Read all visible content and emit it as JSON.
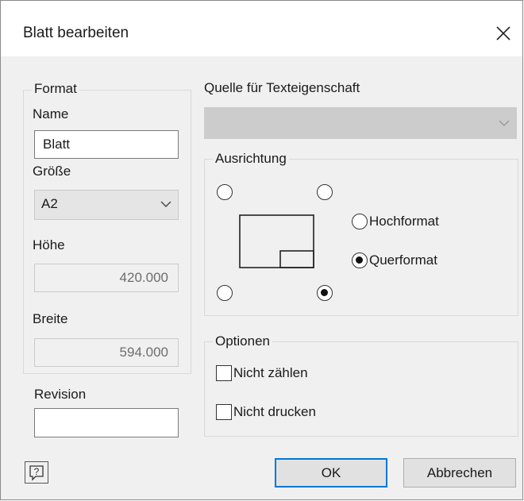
{
  "dialog": {
    "title": "Blatt bearbeiten",
    "close_icon": "close-icon"
  },
  "format": {
    "legend": "Format",
    "name_label": "Name",
    "name_value": "Blatt",
    "size_label": "Größe",
    "size_value": "A2",
    "height_label": "Höhe",
    "height_value": "420.000",
    "width_label": "Breite",
    "width_value": "594.000"
  },
  "revision": {
    "label": "Revision",
    "value": ""
  },
  "text_source": {
    "label": "Quelle für Texteigenschaft",
    "value": ""
  },
  "orientation": {
    "legend": "Ausrichtung",
    "title_block_corner": "bottom-right",
    "portrait_label": "Hochformat",
    "landscape_label": "Querformat",
    "selected": "Querformat"
  },
  "options": {
    "legend": "Optionen",
    "exclude_count_label": "Nicht zählen",
    "exclude_count_checked": false,
    "exclude_print_label": "Nicht drucken",
    "exclude_print_checked": false
  },
  "buttons": {
    "help_icon": "help-icon",
    "ok_label": "OK",
    "cancel_label": "Abbrechen"
  },
  "colors": {
    "accent": "#0078d7",
    "dialog_bg": "#f0f0f0"
  }
}
